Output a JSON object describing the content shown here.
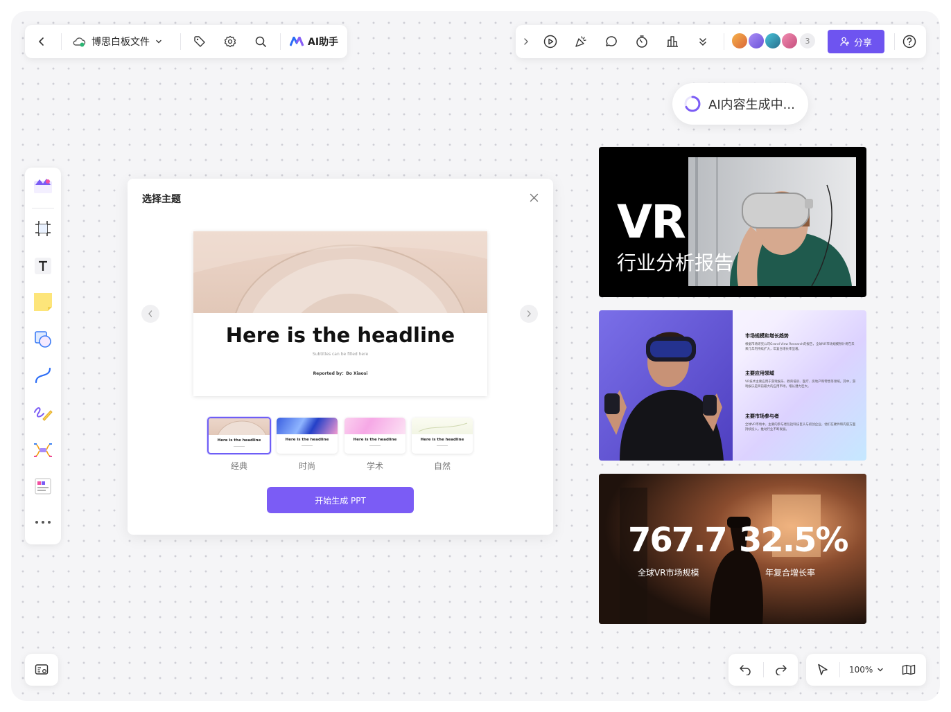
{
  "topbar_left": {
    "file_name": "博思白板文件",
    "ai_label": "AI助手"
  },
  "topbar_right": {
    "extra_count": "3",
    "share_label": "分享"
  },
  "ai_status": "AI内容生成中...",
  "dialog": {
    "title": "选择主题",
    "preview": {
      "headline": "Here is the headline",
      "subtitle": "Subtitles can be filled here",
      "reported_by": "Reported by：Bo Xiaosi"
    },
    "themes": [
      {
        "label": "经典",
        "headline": "Here is the headline",
        "selected": true
      },
      {
        "label": "时尚",
        "headline": "Here is the headline",
        "selected": false
      },
      {
        "label": "学术",
        "headline": "Here is the headline",
        "selected": false
      },
      {
        "label": "自然",
        "headline": "Here is the headline",
        "selected": false
      }
    ],
    "generate_label": "开始生成 PPT"
  },
  "slides": {
    "s1": {
      "title": "VR",
      "subtitle": "行业分析报告"
    },
    "s2": {
      "sections": [
        {
          "heading": "市场规模和增长趋势",
          "body": "根据市场研究公司Grand View Research的报告，全球VR市场规模预计将在未来几年内持续扩大，年复合增长率显著。"
        },
        {
          "heading": "主要应用领域",
          "body": "VR技术主要应用于游戏娱乐、教育培训、医疗、房地产和零售等领域。其中，游戏娱乐是目前最大的应用市场，增长潜力巨大。"
        },
        {
          "heading": "主要市场参与者",
          "body": "全球VR市场中，主要的参与者包括科技巨头与初创企业，他们在硬件和内容方面持续投入，推动行业不断发展。"
        }
      ]
    },
    "s3": {
      "stat1_value": "767.7",
      "stat1_label": "全球VR市场规模",
      "stat2_value": "32.5%",
      "stat2_label": "年复合增长率"
    }
  },
  "bottom": {
    "zoom": "100%"
  },
  "colors": {
    "accent": "#7b5cf5",
    "share": "#6e54f0"
  }
}
